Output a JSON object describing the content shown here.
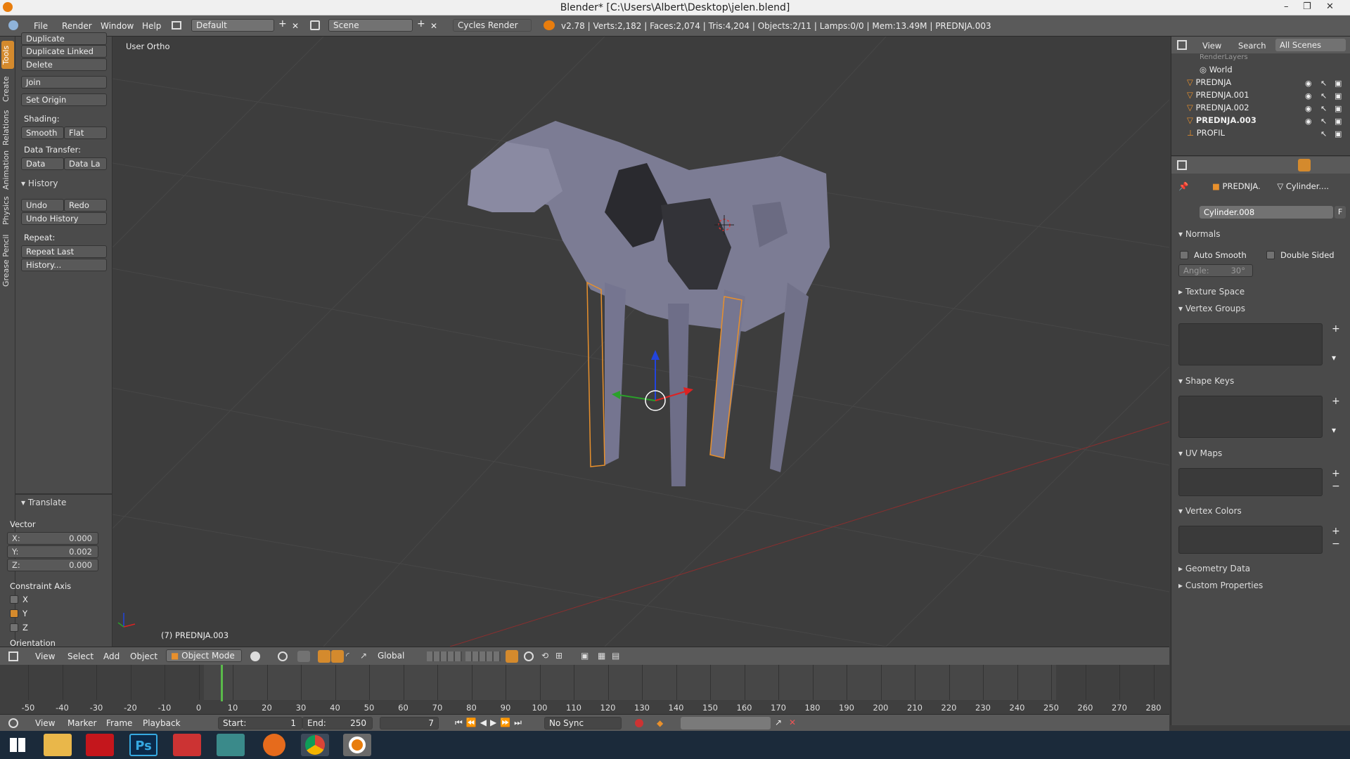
{
  "window": {
    "title": "Blender* [C:\\Users\\Albert\\Desktop\\jelen.blend]",
    "minimize": "–",
    "maximize": "❐",
    "close": "✕"
  },
  "topbar": {
    "menus": [
      "File",
      "Render",
      "Window",
      "Help"
    ],
    "layout": "Default",
    "scene": "Scene",
    "engine": "Cycles Render",
    "stats": "v2.78 | Verts:2,182 | Faces:2,074 | Tris:4,204 | Objects:2/11 | Lamps:0/0 | Mem:13.49M | PREDNJA.003"
  },
  "left_tabs": [
    "Tools",
    "Create",
    "Relations",
    "Animation",
    "Physics",
    "Grease Pencil"
  ],
  "toolshelf": {
    "buttons_top": [
      "Duplicate",
      "Duplicate Linked",
      "Delete",
      "Join",
      "Set Origin"
    ],
    "shading_label": "Shading:",
    "shading": [
      "Smooth",
      "Flat"
    ],
    "data_transfer_label": "Data Transfer:",
    "data_transfer": [
      "Data",
      "Data La"
    ],
    "history_title": "History",
    "undo": "Undo",
    "redo": "Redo",
    "undo_history": "Undo History",
    "repeat_label": "Repeat:",
    "repeat_last": "Repeat Last",
    "history_more": "History..."
  },
  "operator": {
    "title": "Translate",
    "vector_label": "Vector",
    "x_label": "X:",
    "x": "0.000",
    "y_label": "Y:",
    "y": "0.002",
    "z_label": "Z:",
    "z": "0.000",
    "constraint_label": "Constraint Axis",
    "axes": [
      "X",
      "Y",
      "Z"
    ],
    "axes_checked": [
      false,
      true,
      false
    ],
    "orientation_label": "Orientation"
  },
  "viewport": {
    "view_label": "User Ortho",
    "object_label": "(7) PREDNJA.003"
  },
  "outliner": {
    "view": "View",
    "search": "Search",
    "scope": "All Scenes",
    "items": [
      "RenderLayers",
      "World",
      "PREDNJA",
      "PREDNJA.001",
      "PREDNJA.002",
      "PREDNJA.003",
      "PROFIL"
    ]
  },
  "properties": {
    "breadcrumb_obj": "PREDNJA.",
    "breadcrumb_mesh": "Cylinder....",
    "mesh_name": "Cylinder.008",
    "fake_user": "F",
    "normals": "Normals",
    "auto_smooth": "Auto Smooth",
    "double_sided": "Double Sided",
    "angle_label": "Angle:",
    "angle": "30°",
    "texture_space": "Texture Space",
    "vertex_groups": "Vertex Groups",
    "shape_keys": "Shape Keys",
    "uv_maps": "UV Maps",
    "vertex_colors": "Vertex Colors",
    "geometry_data": "Geometry Data",
    "custom_properties": "Custom Properties"
  },
  "vp_header": {
    "menus": [
      "View",
      "Select",
      "Add",
      "Object"
    ],
    "mode": "Object Mode",
    "orientation": "Global"
  },
  "timeline": {
    "ticks": [
      "-50",
      "-40",
      "-30",
      "-20",
      "-10",
      "0",
      "10",
      "20",
      "30",
      "40",
      "50",
      "60",
      "70",
      "80",
      "90",
      "100",
      "110",
      "120",
      "130",
      "140",
      "150",
      "160",
      "170",
      "180",
      "190",
      "200",
      "210",
      "220",
      "230",
      "240",
      "250",
      "260",
      "270",
      "280"
    ],
    "current_frame": 7
  },
  "tl_header": {
    "menus": [
      "View",
      "Marker",
      "Frame",
      "Playback"
    ],
    "start_label": "Start:",
    "start": "1",
    "end_label": "End:",
    "end": "250",
    "frame": "7",
    "sync": "No Sync"
  },
  "taskbar": {
    "icons": [
      "windows-start-icon",
      "file-explorer-icon",
      "acrobat-icon",
      "photoshop-icon",
      "sketchup-icon",
      "3dsmax-icon",
      "firefox-icon",
      "chrome-icon",
      "blender-icon"
    ],
    "ps_label": "Ps"
  },
  "colors": {
    "accent": "#d48a2d",
    "selection_outline": "#e8902c"
  }
}
